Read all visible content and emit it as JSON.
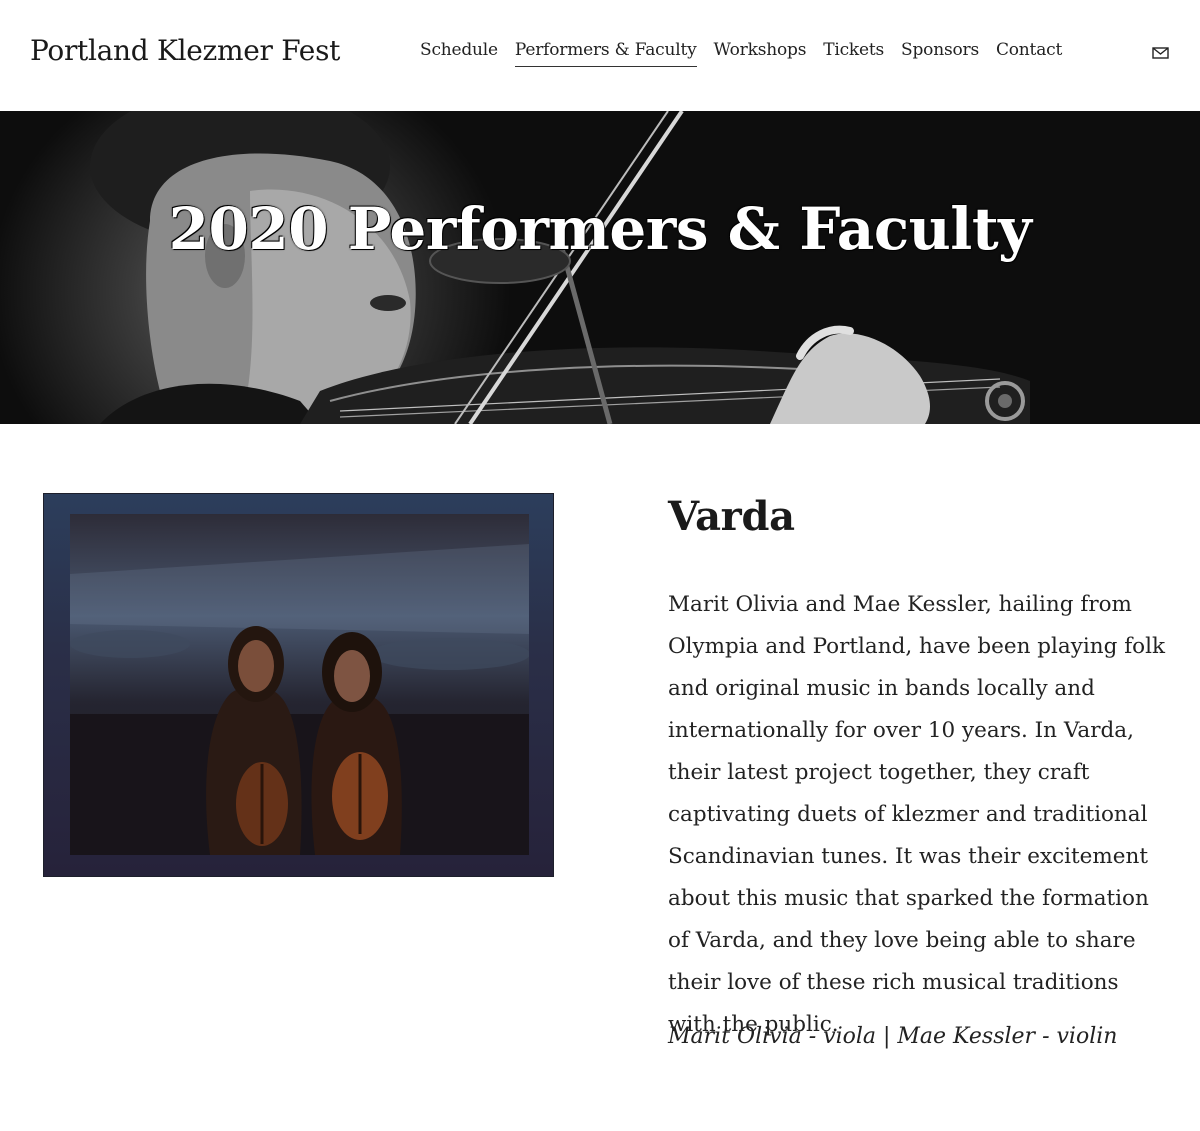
{
  "header": {
    "site_title": "Portland Klezmer Fest",
    "nav": [
      {
        "label": "Schedule",
        "active": false
      },
      {
        "label": "Performers & Faculty",
        "active": true
      },
      {
        "label": "Workshops",
        "active": false
      },
      {
        "label": "Tickets",
        "active": false
      },
      {
        "label": "Sponsors",
        "active": false
      },
      {
        "label": "Contact",
        "active": false
      }
    ],
    "mail_icon": "envelope-icon"
  },
  "banner": {
    "title": "2020 Performers & Faculty",
    "image": "violinist-photo"
  },
  "performer": {
    "image": "duo-with-violins-photo",
    "name": "Varda",
    "bio": "Marit Olivia and Mae Kessler, hailing from Olympia and Portland, have been playing folk and original music in bands locally and internationally for over 10 years. In Varda, their latest project together, they craft captivating duets of klezmer and traditional Scandinavian tunes. It was their excitement about this music that sparked the formation of Varda, and they love being able to share their love of these rich musical traditions with the public.",
    "credits": "Marit Olivia - viola | Mae Kessler - violin"
  },
  "colors": {
    "text": "#1a1a1a",
    "background": "#ffffff",
    "banner_bg": "#0a0a0a"
  }
}
